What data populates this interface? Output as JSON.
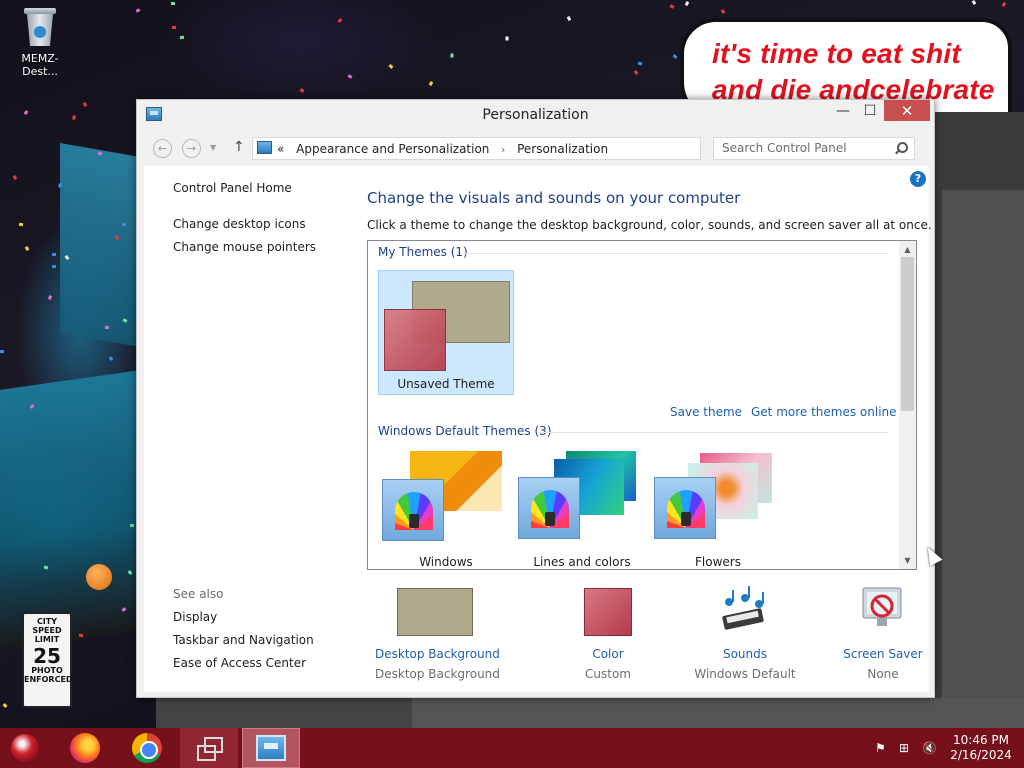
{
  "desktop": {
    "icon_label": "MEMZ-Dest...",
    "bubble_lines": [
      "it's time to eat shit",
      "and die andcelebrate"
    ],
    "sign": {
      "line1": "CITY",
      "line2": "SPEED",
      "line3": "LIMIT",
      "value": "25",
      "line4": "PHOTO",
      "line5": "ENFORCED"
    }
  },
  "window": {
    "title": "Personalization",
    "minimize_glyph": "—",
    "maximize_glyph": "☐",
    "close_glyph": "✕"
  },
  "nav": {
    "back_glyph": "←",
    "forward_glyph": "→",
    "dropdown_glyph": "▼",
    "up_glyph": "↑",
    "address_prefix": "«",
    "breadcrumb": [
      "Appearance and Personalization",
      "Personalization"
    ],
    "breadcrumb_sep": "›",
    "address_dropdown_glyph": "⌵",
    "refresh_glyph": "↻",
    "search_placeholder": "Search Control Panel"
  },
  "sidebar": {
    "home": "Control Panel Home",
    "links": [
      "Change desktop icons",
      "Change mouse pointers"
    ],
    "see_also_label": "See also",
    "see_also": [
      "Display",
      "Taskbar and Navigation",
      "Ease of Access Center"
    ]
  },
  "main": {
    "help_glyph": "?",
    "heading": "Change the visuals and sounds on your computer",
    "subtitle": "Click a theme to change the desktop background, color, sounds, and screen saver all at once.",
    "my_themes_label": "My Themes (1)",
    "unsaved_theme": "Unsaved Theme",
    "save_theme": "Save theme",
    "get_more": "Get more themes online",
    "default_themes_label": "Windows Default Themes (3)",
    "default_themes": [
      "Windows",
      "Lines and colors",
      "Flowers"
    ],
    "scroll_up_glyph": "▲",
    "scroll_down_glyph": "▼"
  },
  "settings": [
    {
      "title": "Desktop Background",
      "sub": "Desktop Background"
    },
    {
      "title": "Color",
      "sub": "Custom"
    },
    {
      "title": "Sounds",
      "sub": "Windows Default"
    },
    {
      "title": "Screen Saver",
      "sub": "None"
    }
  ],
  "taskbar": {
    "time": "10:46 PM",
    "date": "2/16/2024",
    "flag_glyph": "⚑",
    "network_glyph": "⊞",
    "volume_glyph": "🔇"
  },
  "colors": {
    "taskbar": "#76101a",
    "close_button": "#c7504f",
    "link": "#1e5fb0",
    "heading": "#1e3f8f",
    "bubble_text": "#e3101e",
    "desktop_background_swatch": "#b1a98b",
    "color_swatch": "#c9535f"
  }
}
